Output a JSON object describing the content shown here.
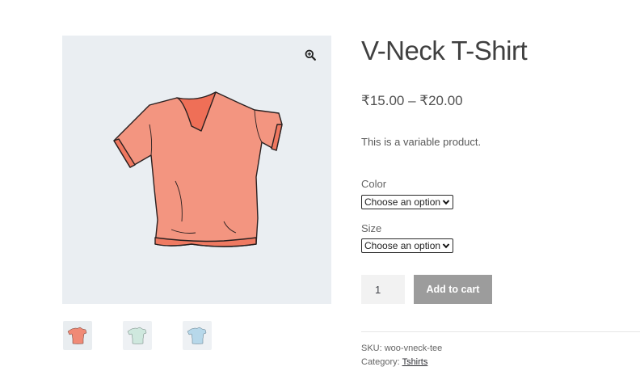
{
  "product": {
    "title": "V-Neck T-Shirt",
    "price": "₹15.00 – ₹20.00",
    "description": "This is a variable product."
  },
  "gallery": {
    "zoom_icon": "zoom-in-icon",
    "thumbnails": [
      {
        "color": "#f08a76",
        "name": "coral-tshirt"
      },
      {
        "color": "#cfe8de",
        "name": "mint-tshirt"
      },
      {
        "color": "#b7d8ea",
        "name": "blue-tshirt"
      }
    ],
    "main_color": "#f39580"
  },
  "variations": {
    "color_label": "Color",
    "color_value": "Choose an option",
    "size_label": "Size",
    "size_value": "Choose an option"
  },
  "cart": {
    "quantity": "1",
    "button_label": "Add to cart",
    "button_color": "#9c9c9c"
  },
  "meta": {
    "sku": "SKU: woo-vneck-tee",
    "category_prefix": "Category:",
    "category_link": "Tshirts"
  }
}
